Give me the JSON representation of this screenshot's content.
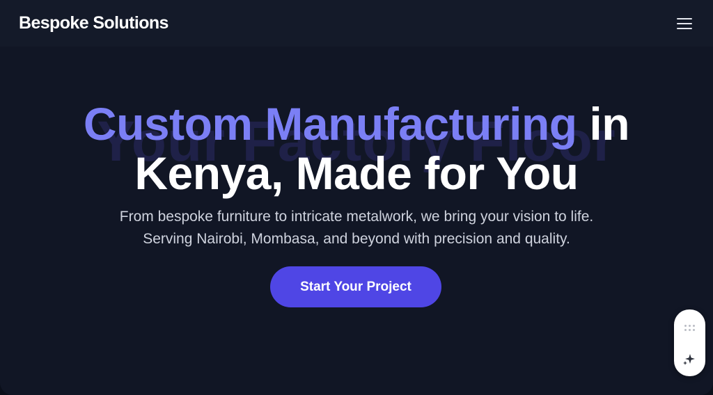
{
  "navbar": {
    "brand": "Bespoke Solutions",
    "menu_icon": "hamburger-menu-icon"
  },
  "hero": {
    "watermark": "Your Factory Floor",
    "headline_accent": "Custom Manufacturing",
    "headline_rest_1": " in",
    "headline_rest_2": "Kenya, Made for You",
    "subtext_line_1": "From bespoke furniture to intricate metalwork, we bring your vision to life.",
    "subtext_line_2": "Serving Nairobi, Mombasa, and beyond with precision and quality.",
    "cta_label": "Start Your Project"
  },
  "widget": {
    "grip_icon": "drag-handle-icon",
    "action_icon": "sparkle-icon"
  },
  "colors": {
    "background": "#111625",
    "navbar": "#141a29",
    "accent": "#7b7ff5",
    "button": "#4f46e5",
    "watermark": "#1f2148"
  }
}
